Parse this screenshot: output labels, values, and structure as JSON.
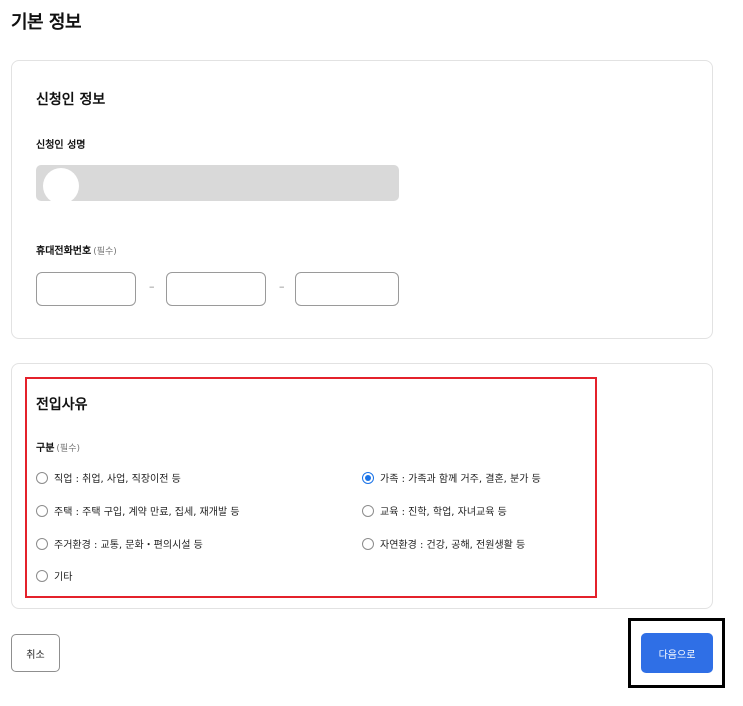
{
  "page": {
    "title": "기본 정보"
  },
  "applicant": {
    "title": "신청인 정보",
    "name_label": "신청인 성명",
    "phone_label": "휴대전화번호",
    "phone_required": "(필수)",
    "phone_separator": "–"
  },
  "reason": {
    "title": "전입사유",
    "category_label": "구분",
    "category_required": "(필수)",
    "options": [
      {
        "label": "직업 : 취업, 사업, 직장이전 등",
        "checked": false
      },
      {
        "label": "가족 : 가족과 함께 거주, 결혼, 분가 등",
        "checked": true
      },
      {
        "label": "주택 : 주택 구입, 계약 만료, 집세, 재개발 등",
        "checked": false
      },
      {
        "label": "교육 : 진학, 학업, 자녀교육 등",
        "checked": false
      },
      {
        "label": "주거환경 : 교통, 문화・편의시설 등",
        "checked": false
      },
      {
        "label": "자연환경 : 건강, 공해, 전원생활 등",
        "checked": false
      },
      {
        "label": "기타",
        "checked": false
      }
    ]
  },
  "actions": {
    "cancel_label": "취소",
    "next_label": "다음으로"
  },
  "colors": {
    "primary": "#2f6fe6",
    "highlight_red": "#e4212b",
    "highlight_black": "#000000"
  }
}
